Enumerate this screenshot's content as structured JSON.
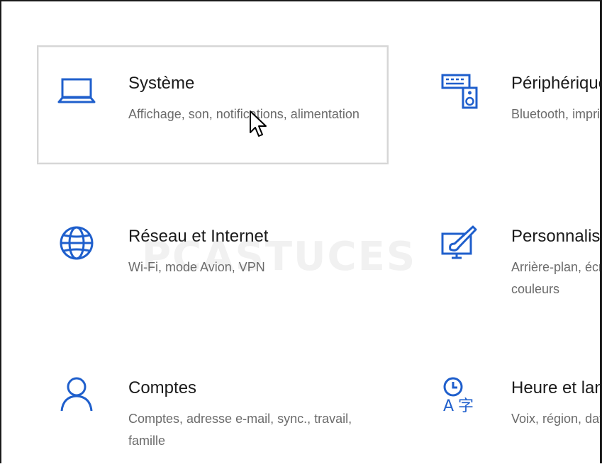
{
  "accent": "#1f5fcc",
  "left_column": [
    {
      "title": "Système",
      "desc": "Affichage, son, notifications, alimentation",
      "icon": "laptop-icon",
      "hover": true
    },
    {
      "title": "Réseau et Internet",
      "desc": "Wi-Fi, mode Avion, VPN",
      "icon": "globe-icon",
      "hover": false
    },
    {
      "title": "Comptes",
      "desc": "Comptes, adresse e-mail, sync., travail, famille",
      "icon": "person-icon",
      "hover": false
    }
  ],
  "right_column": [
    {
      "title": "Périphériques",
      "desc": "Bluetooth, imprimantes, souris",
      "icon": "keyboard-speaker-icon"
    },
    {
      "title": "Personnalisation",
      "desc": "Arrière-plan, écran de verrouillage, couleurs",
      "icon": "paint-monitor-icon"
    },
    {
      "title": "Heure et langue",
      "desc": "Voix, région, date",
      "icon": "clock-language-icon"
    }
  ],
  "watermark": "PCASTUCES"
}
